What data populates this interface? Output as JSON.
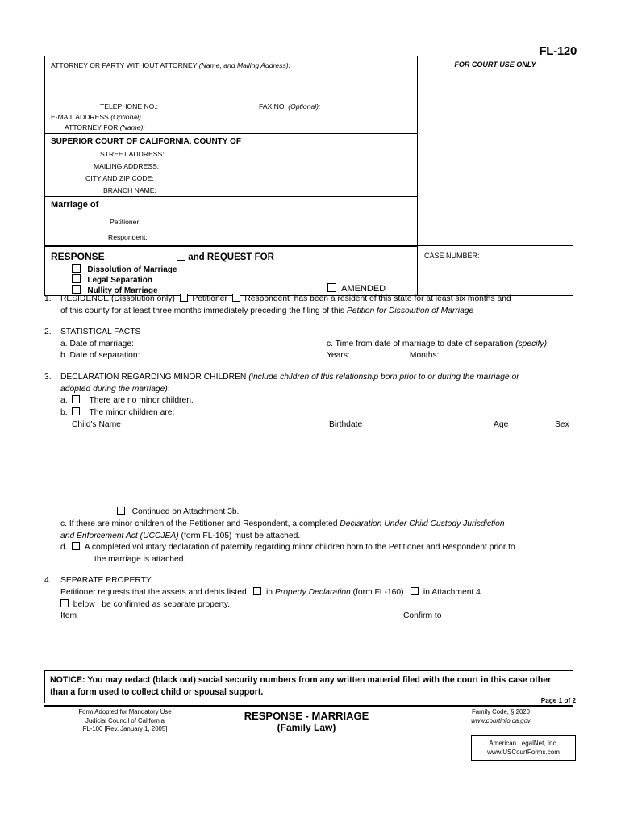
{
  "form": {
    "number": "FL-120"
  },
  "caption": {
    "attorney_header": "ATTORNEY OR PARTY WITHOUT ATTORNEY",
    "attorney_header_italic": "(Name, and Mailing Address):",
    "telephone_label": "TELEPHONE NO.:",
    "fax_label": "FAX NO.",
    "fax_label_italic": "(Optional):",
    "email_label": "E-MAIL ADDRESS",
    "email_label_italic": "(Optional)",
    "attorney_for_label": "ATTORNEY FOR",
    "attorney_for_italic": "(Name):",
    "court_use_only": "FOR COURT USE ONLY",
    "court_title": "SUPERIOR COURT OF CALIFORNIA, COUNTY OF",
    "court_fields": [
      "STREET ADDRESS:",
      "MAILING ADDRESS:",
      "CITY AND ZIP CODE:",
      "BRANCH NAME:"
    ],
    "marriage_of": "Marriage of",
    "petitioner_label": "Petitioner:",
    "respondent_label": "Respondent:",
    "case_number_label": "CASE NUMBER:"
  },
  "response_block": {
    "title": "RESPONSE",
    "and_request_for": "and REQUEST FOR",
    "options": [
      "Dissolution of Marriage",
      "Legal Separation",
      "Nullity of Marriage"
    ],
    "amended": "AMENDED"
  },
  "sections": {
    "s1": {
      "num": "1.",
      "lead": "RESIDENCE (Dissolution only)",
      "petitioner": "Petitioner",
      "respondent": "Respondent",
      "tail": "has been a resident of this state for at least six months and",
      "line2_a": "of this county for at least three months immediately preceding the filing of this ",
      "line2_italic": "Petition for Dissolution of Marriage"
    },
    "s2": {
      "num": "2.",
      "title": "STATISTICAL FACTS",
      "a": "a. Date of marriage:",
      "b": "b. Date of separation:",
      "c": "c. Time from date of marriage to date of separation ",
      "c_italic": "(specify)",
      "c_tail": ":",
      "years": "Years:",
      "months": "Months:"
    },
    "s3": {
      "num": "3.",
      "title": "DECLARATION REGARDING MINOR CHILDREN ",
      "title_italic": "(include children of this relationship born prior to or during the marriage or",
      "title_italic2": "adopted during the marriage)",
      "title_tail": ":",
      "a_ltr": "a.",
      "a_text": "There are no minor children.",
      "b_ltr": "b.",
      "b_text": "The minor children are:",
      "col_name": "Child's Name",
      "col_birthdate": "Birthdate",
      "col_age": "Age",
      "col_sex": "Sex",
      "continued": "Continued on Attachment 3b.",
      "c_text_a": "c. If there are minor children of the Petitioner and Respondent, a completed ",
      "c_italic": "Declaration Under Child Custody Jurisdiction",
      "c_italic2": "and Enforcement Act (UCCJEA)",
      "c_text_b": " (form FL-105) must be attached.",
      "d_ltr": "d.",
      "d_text": "A completed voluntary declaration of paternity regarding minor children born to the Petitioner and Respondent prior to",
      "d_text2": "the marriage is attached."
    },
    "s4": {
      "num": "4.",
      "title": "SEPARATE PROPERTY",
      "lead": "Petitioner requests that the assets and debts listed",
      "opt1_pre": "in ",
      "opt1_italic": "Property Declaration",
      "opt1_post": " (form FL-160)",
      "opt2": "in Attachment 4",
      "below": "below",
      "confirmed": "be confirmed as separate property.",
      "col_item": "Item",
      "col_confirm": "Confirm to"
    }
  },
  "notice": {
    "text": "NOTICE: You may redact (black out) social security numbers from any written material filed with the court in this case other than a form used to collect child or spousal support."
  },
  "footer": {
    "page_of": "Page 1 of 2",
    "adopted_1": "Form Adopted for Mandatory Use",
    "adopted_2": "Judicial Council of California",
    "adopted_3": "FL-100 [Rev. January 1, 2005]",
    "title": "RESPONSE - MARRIAGE",
    "subtitle": "(Family Law)",
    "code": "Family Code, § 2020",
    "website": "www.courtinfo.ca.gov",
    "legalnet_1": "American LegalNet, Inc.",
    "legalnet_2": "www.USCourtForms.com"
  }
}
